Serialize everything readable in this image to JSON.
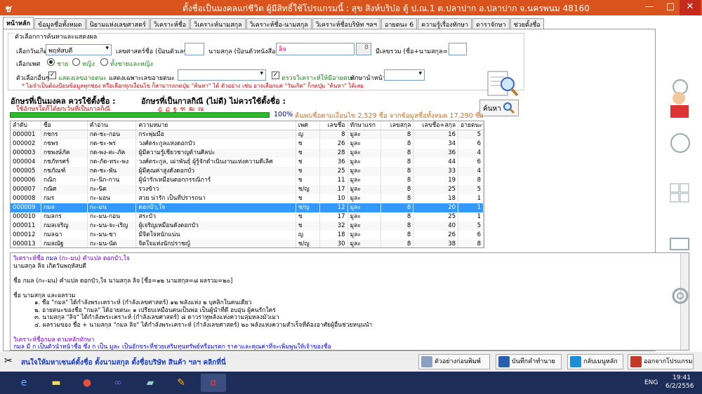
{
  "window": {
    "title": "ตั้งชื่อเป็นมงคลแก่ชีวิต ผู้มีสิทธิ์ใช้โปรแกรมนี้ : สุข  สิงห์บริบ๋อ    ตู้ ป.ณ.1 ต.ปลาปาก อ.ปลาปาก จ.นครพนม 48160",
    "app_glyph": "ช",
    "min": "—",
    "max": "□",
    "close": "✕"
  },
  "tabs": [
    "หน้าหลัก",
    "ข้อมูลชื่อทั้งหมด",
    "นิยามแห่งเลขศาสตร์",
    "วิเคราะห์ชื่อ",
    "วิเคราะห์นามสกุล",
    "วิเคราะห์ชื่อ-นามสกุล",
    "วิเคราะห์ชื่อบริษัท ฯลฯ",
    "อายตนะ 6",
    "ความรู้เรื่องทักษา",
    "ดาราจักษา",
    "ช่วยตั้งชื่อ"
  ],
  "search": {
    "legend": "ตัวเลือกการค้นหาและแสดงผล",
    "birthday_label": "เลือกวันเกิด",
    "birthday_value": "พฤหัสบดี",
    "sum_label": "เลขศาสตร์ชื่อ (ป้อนตัวเลข)",
    "sum_value": "",
    "surname_label": "นามสกุล (ป้อนตัวหนังสือ)",
    "surname_value": "ลิจ",
    "surname_count": "8",
    "total_label": "มีเลขรวม (ชื่อ+นามสกุล=?)",
    "total_value": "",
    "gender_label": "เลือกเพศ",
    "gender_male": "ชาย",
    "gender_female": "หญิง",
    "gender_both": "ทั้งชายและหญิง",
    "other_label": "ตัวเลือกอื่นๆ",
    "show_ayatana": "แสดงเลขอายตนะ",
    "show_only_ayatana": "แสดงเฉพาะเลขอายตนะ",
    "check_ayatana": "ตรวจวิเคราะห์ให้มีอายตนะ",
    "taksa_label": "ทักษานำหน้า",
    "note": "* ไม่จำเป็นต้องป้อนข้อมูลทุกช่อง หรือเลือกทุกเงื่อนไข ก็สามารถกดปุ่ม \"ค้นหา\" ได้  ตัวอย่าง เช่น อาจเลือกแค่ \"วันเกิด\" ก็กดปุ่ม \"ค้นหา\" ได้เลย",
    "search_button": "ค้นหา"
  },
  "section": {
    "auspicious_title": "อักษรที่เป็นมงคล ควรใช้ตั้งชื่อ :",
    "auspicious_value": "ใช้อักษรใดก็ได้ยกเว้นที่เป็นกาลกิณี",
    "kalakini_title": "อักษรที่เป็นกาลกิณี (ไม่ดี) ไม่ควรใช้ตั้งชื่อ :",
    "kalakini_value": "ฎ ฏ ฐ ฑ ฒ ณ"
  },
  "progress": {
    "value": 1.0,
    "percent": "100%",
    "text": "ค้นพบชื่อตามเงื่อนไข 2,529 ชื่อ จากข้อมูลชื่อทั้งหมด 17,290 ชื่อ"
  },
  "table": {
    "headers": [
      "ลำดับ",
      "ชื่อ",
      "คำอ่าน",
      "ความหมาย",
      "เพศ",
      "เลขชื่อ",
      "ทักษาแรก",
      "เลขสกุล",
      "เลขชื่อ+สกุล",
      "อายตนะชื่อ"
    ],
    "rows": [
      [
        "000001",
        "กชกร",
        "กด-ชะ-กอน",
        "กระพุ่มมือ",
        "ญ",
        "8",
        "มูละ",
        "8",
        "16",
        "5"
      ],
      [
        "000002",
        "กชพร",
        "กด-ชะ-พร",
        "วงศ์ตระกูลแห่งดอกบัว",
        "ช",
        "26",
        "มูละ",
        "8",
        "34",
        "6"
      ],
      [
        "000003",
        "กชพงษ์ภัค",
        "กด-พง-สะ-ภัค",
        "ผู้มีความรู้เชี่ยวชาญด้านศิลปะ",
        "ช",
        "28",
        "มูละ",
        "8",
        "36",
        "4"
      ],
      [
        "000004",
        "กชภัทรศร์",
        "กด-ภัด-ทระ-พง",
        "วงศ์ตระกูล, เผ่าพันธุ์ ผู้รู้จักดำเนินงานแห่งความดีเลิศ",
        "ช",
        "36",
        "มูละ",
        "8",
        "44",
        "6"
      ],
      [
        "000005",
        "กชภัณฑ์",
        "กด-ชะ-พัน",
        "ผู้มีคุณค่าสูงดังดอกบัว",
        "ช",
        "25",
        "มูละ",
        "8",
        "33",
        "4"
      ],
      [
        "000006",
        "กณิก",
        "กะ-นิก-กาน",
        "ผู้นำรักเหมือนดอกกรรณิการ์",
        "ช",
        "11",
        "มูละ",
        "8",
        "19",
        "8"
      ],
      [
        "000007",
        "กณิศ",
        "กะ-นิด",
        "รวงข้าว",
        "ช/ญ",
        "17",
        "มูละ",
        "8",
        "25",
        "5"
      ],
      [
        "000008",
        "กมร",
        "กะ-มอน",
        "สวย น่ารัก เป็นที่ปรารถนา",
        "ช",
        "10",
        "มูละ",
        "8",
        "18",
        "1"
      ],
      [
        "000009",
        "กมล",
        "กะ-มน",
        "ดอกบัว,ใจ",
        "ช/ญ",
        "12",
        "มูละ",
        "8",
        "20",
        "1"
      ],
      [
        "000010",
        "กมลกร",
        "กะ-มน-กอน",
        "สระบัว",
        "ช",
        "17",
        "มูละ",
        "8",
        "25",
        "1"
      ],
      [
        "000011",
        "กมลเจริญ",
        "กะ-มน-จะ-เริญ",
        "ผู้เจริญเหมือนดังดอกบัว",
        "ช",
        "32",
        "มูละ",
        "8",
        "40",
        "5"
      ],
      [
        "000012",
        "กมลฉา",
        "กะ-มน-ชา",
        "มีจิตใจหนักแน่น",
        "ญ",
        "18",
        "มูละ",
        "8",
        "26",
        "6"
      ],
      [
        "000013",
        "กมลณัฐ",
        "กะ-มน-นัด",
        "จิตใจแห่งนักปราชญ์",
        "ช/ญ",
        "30",
        "มูละ",
        "8",
        "38",
        "8"
      ]
    ],
    "selected_index": 8
  },
  "detail": {
    "line1_prefix": "วิเคราะห์ชื่อ",
    "line1_name": "กมล",
    "line1_read": "(กะ-มน)",
    "line1_mean": "คำแปล ดอกบัว,ใจ",
    "line2": "นามสกุล ลิจ เกิดวันพฤหัสบดี",
    "line3": "ชื่อ กมล (กะ-มน) คำแปล ดอกบัว,ใจ  นามสกุล ลิจ [ชื่อ=๑๒ นามสกุล=๘ ผลรวม=๒๐]",
    "line4": "ชื่อ นามสกุล และผลรวม",
    "line5": "๑. ชื่อ \"กมล\" ได้กำลังพระเคราะห์ (กำลังเลขศาสตร์) ๑๒  พลังแห่ง ๒ บุคลิกในคนเดียว",
    "line6": "๒. อายตนะของชื่อ \"กมล\" ได้อายตนะ ๑ เปรียบเหมือนคนเป็นพ่อ เป็นผู้นำที่ดี อบอุ่น ผู้คนรักใคร่",
    "line7": "๓. นามสกุล \"ลิจ\" ได้กำลังพระเคราะห์ (กำลังเลขศาสตร์) ๘  ดาวราหูพลังแห่งความลุ่มหลงมัวเมา",
    "line8": "๔. ผลรวมของ ชื่อ + นามสกุล \"กมล ลิจ\" ได้กำลังพระเคราะห์ (กำลังเลขศาสตร์) ๒๐  พลังแห่งความสำเร็จที่ต้องอาศัยผู้อื่นช่วยหนุนนำ",
    "line9": "วิเคราะห์ชื่อกมล ตามหลักทักษา",
    "line10": "กมล มี ก เป็นตัวนำหน้าชื่อ  ซึ่ง ก เป็น มูละ เป็นอักขระที่ช่วยเสริมทุนทรัพย์หรือมรดก ราคาและคุณค่าที่จะเพิ่มพูนให้เจ้าของชื่อ"
  },
  "bottom": {
    "promo": "สนใจให้มหาเซนต์ตั้งชื่อ ตั้งนามสกุล ตั้งชื่อบริษัท  สินค้า ฯลฯ คลิกที่นี่",
    "print_preview": "ตัวอย่างก่อนพิมพ์",
    "save": "บันทึกคำทำนาย",
    "home": "กลับเมนูหลัก",
    "exit": "ออกจากโปรแกรม"
  },
  "taskbar": {
    "lang": "ENG",
    "time": "19:41",
    "date": "6/2/2556"
  },
  "colors": {
    "titlebar": "#d9541c",
    "selected_row": "#3399ff",
    "progress": "#2eb82e",
    "taskbar": "#1c2d59"
  }
}
